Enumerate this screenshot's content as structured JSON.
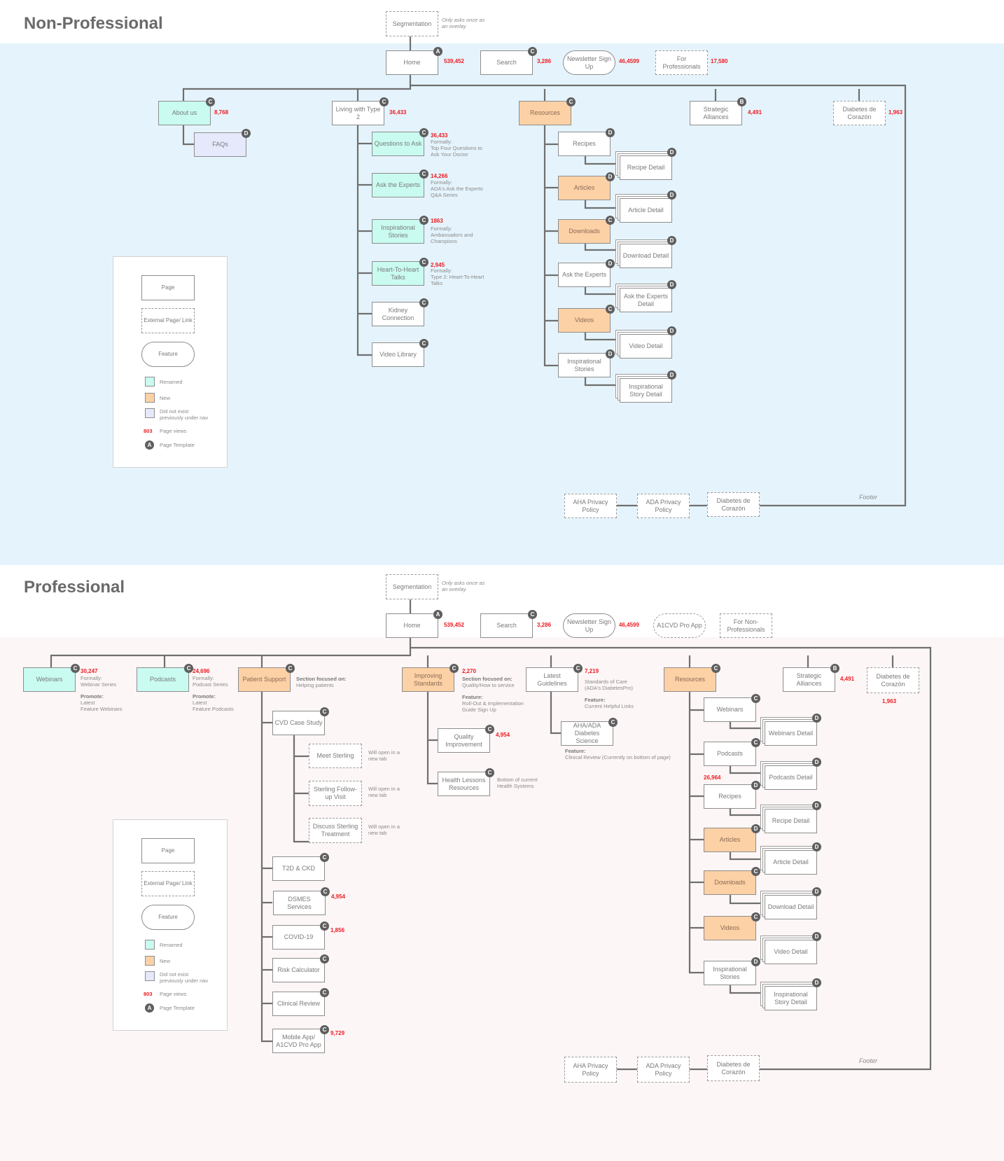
{
  "colors": {
    "renamed": "#c9fbf0",
    "new": "#fdd1a6",
    "not_existing": "#e6e9fc",
    "page_views": "#ee1c24",
    "badge": "#5f5f5f",
    "non_professional_bg": "#e5f4fc",
    "professional_bg": "#fdf6f6"
  },
  "legend": {
    "page": "Page",
    "external": "External Page/ Link",
    "feature": "Feature",
    "renamed": "Renamed",
    "new": "New",
    "not_existing": "Did not exist\npreviously under nav",
    "views_sample": "803",
    "views_label": "Page views",
    "template_sample": "A",
    "template_label": "Page Template"
  },
  "non_professional": {
    "title": "Non-Professional",
    "segmentation": "Segmentation",
    "segmentation_note": "Only asks once as\nan overlay",
    "footer_label": "Footer",
    "nodes": {
      "home": {
        "label": "Home",
        "badge": "A",
        "views": "539,452"
      },
      "search": {
        "label": "Search",
        "badge": "C",
        "views": "3,286"
      },
      "newsletter": {
        "label": "Newsletter Sign Up",
        "views": "46,4599"
      },
      "for_professionals": {
        "label": "For Professionals",
        "views": "17,580"
      },
      "about": {
        "label": "About us",
        "badge": "C",
        "views": "8,768"
      },
      "faqs": {
        "label": "FAQs",
        "badge": "D"
      },
      "living": {
        "label": "Living with Type 2",
        "badge": "C",
        "views": "36,433"
      },
      "questions": {
        "label": "Questions to Ask",
        "badge": "C",
        "views": "36,433",
        "note": "Formally:\nTop Four Questions to\nAsk Your Doctor"
      },
      "ask_experts": {
        "label": "Ask the Experts",
        "badge": "C",
        "views": "14,266",
        "note": "Formally:\nADA's Ask the Experts\nQ&A Series"
      },
      "inspirational": {
        "label": "Inspirational Stories",
        "badge": "C",
        "views": "1863",
        "note": "Formally:\nAmbassadors and\nChampions"
      },
      "heart": {
        "label": "Heart-To-Heart Talks",
        "badge": "C",
        "views": "2,945",
        "note": "Formally:\nType 2: Heart-To-Heart\nTalks"
      },
      "kidney": {
        "label": "Kidney Connection",
        "badge": "C"
      },
      "video_library": {
        "label": "Video Library",
        "badge": "C"
      },
      "resources": {
        "label": "Resources",
        "badge": "C"
      },
      "recipes": {
        "label": "Recipes",
        "badge": "D"
      },
      "recipe_detail": {
        "label": "Recipe Detail",
        "badge": "D"
      },
      "articles": {
        "label": "Articles",
        "badge": "D"
      },
      "article_detail": {
        "label": "Article Detail",
        "badge": "D"
      },
      "downloads": {
        "label": "Downloads",
        "badge": "C"
      },
      "download_detail": {
        "label": "Download Detail",
        "badge": "D"
      },
      "res_ask": {
        "label": "Ask the Experts",
        "badge": "D"
      },
      "res_ask_detail": {
        "label": "Ask the Experts Detail",
        "badge": "D"
      },
      "videos": {
        "label": "Videos",
        "badge": "C"
      },
      "video_detail": {
        "label": "Video Detail",
        "badge": "D"
      },
      "res_insp": {
        "label": "Inspirational Stories",
        "badge": "D"
      },
      "insp_detail": {
        "label": "Inspirational Story Detail",
        "badge": "D"
      },
      "strategic": {
        "label": "Strategic Alliances",
        "badge": "B",
        "views": "4,491"
      },
      "corazon": {
        "label": "Diabetes de Corazón",
        "views": "1,963"
      },
      "aha_privacy": {
        "label": "AHA Privacy Policy"
      },
      "ada_privacy": {
        "label": "ADA Privacy Policy"
      },
      "footer_corazon": {
        "label": "Diabetes de Corazón"
      }
    }
  },
  "professional": {
    "title": "Professional",
    "segmentation": "Segmentation",
    "segmentation_note": "Only asks once as\nan overlay",
    "footer_label": "Footer",
    "nodes": {
      "home": {
        "label": "Home",
        "badge": "A",
        "views": "539,452"
      },
      "search": {
        "label": "Search",
        "badge": "C",
        "views": "3,286"
      },
      "newsletter": {
        "label": "Newsletter Sign Up",
        "views": "46,4599"
      },
      "a1cvd": {
        "label": "A1CVD Pro App"
      },
      "for_nonpro": {
        "label": "For Non-Professionals"
      },
      "webinars": {
        "label": "Webinars",
        "badge": "C",
        "views": "30,247",
        "note": "Formally:\nWebinar Series",
        "note2_hd": "Promote:",
        "note2": "Latest\nFeature Webinars"
      },
      "podcasts": {
        "label": "Podcasts",
        "badge": "C",
        "views": "24,696",
        "note": "Formally:\nPodcast Series",
        "note2_hd": "Promote:",
        "note2": "Latest\nFeature Podcasts"
      },
      "patient_support": {
        "label": "Patient Support",
        "badge": "C",
        "note_hd": "Section focused on:",
        "note": "Helping patients"
      },
      "cvd_case": {
        "label": "CVD Case Study",
        "badge": "C"
      },
      "meet_sterling": {
        "label": "Meet Sterling",
        "note": "Will open in a\nnew tab"
      },
      "sterling_followup": {
        "label": "Sterling Follow-up Visit",
        "note": "Will open in a\nnew tab"
      },
      "discuss_sterling": {
        "label": "Discuss Sterling Treatment",
        "note": "Will open in a\nnew tab"
      },
      "t2d": {
        "label": "T2D & CKD",
        "badge": "C"
      },
      "dsmes": {
        "label": "DSMES Services",
        "badge": "C",
        "views": "4,954"
      },
      "covid": {
        "label": "COVID-19",
        "badge": "C",
        "views": "1,856"
      },
      "risk": {
        "label": "Risk Calculator",
        "badge": "C"
      },
      "clinical": {
        "label": "Clinical Review",
        "badge": "C"
      },
      "mobile_app": {
        "label": "Mobile App/ A1CVD Pro App",
        "badge": "C",
        "views": "9,729"
      },
      "improving": {
        "label": "Improving Standards",
        "badge": "C",
        "views": "2,270",
        "note_hd": "Section focused on:",
        "note": "Quality/How to service",
        "note2_hd": "Feature:",
        "note2": "Roll-Out & Implementation\nGuide Sign Up"
      },
      "quality": {
        "label": "Quality Improvement",
        "badge": "C",
        "views": "4,954"
      },
      "health_lessons": {
        "label": "Health Lessons Resources",
        "badge": "C",
        "note": "Bottom of current\nHealth Systems"
      },
      "guidelines": {
        "label": "Latest Guidelines",
        "badge": "C",
        "views": "7,219",
        "note": "Standards of Care\n(ADA's DiabetesPro)",
        "note2_hd": "Feature:",
        "note2": "Current Helpful Links"
      },
      "aha_ada": {
        "label": "AHA/ADA Diabetes Science",
        "badge": "C",
        "note_hd": "Feature:",
        "note": "Clinical Review (Currently on bottom of page)"
      },
      "resources": {
        "label": "Resources",
        "badge": "C"
      },
      "r_webinars": {
        "label": "Webinars",
        "badge": "C"
      },
      "r_webinars_detail": {
        "label": "Webinars Detail",
        "badge": "D"
      },
      "r_podcasts": {
        "label": "Podcasts",
        "badge": "C"
      },
      "r_podcasts_detail": {
        "label": "Podcasts Detail",
        "badge": "D"
      },
      "r_recipes": {
        "label": "Recipes",
        "badge": "D",
        "views": "26,964"
      },
      "r_recipe_detail": {
        "label": "Recipe Detail",
        "badge": "D"
      },
      "r_articles": {
        "label": "Articles",
        "badge": "D"
      },
      "r_article_detail": {
        "label": "Article Detail",
        "badge": "D"
      },
      "r_downloads": {
        "label": "Downloads",
        "badge": "C"
      },
      "r_download_detail": {
        "label": "Download Detail",
        "badge": "D"
      },
      "r_videos": {
        "label": "Videos",
        "badge": "C"
      },
      "r_video_detail": {
        "label": "Video Detail",
        "badge": "D"
      },
      "r_insp": {
        "label": "Inspirational Stories",
        "badge": "D"
      },
      "r_insp_detail": {
        "label": "Inspirational Story Detail",
        "badge": "D"
      },
      "strategic": {
        "label": "Strategic Alliances",
        "badge": "B",
        "views": "4,491"
      },
      "corazon": {
        "label": "Diabetes de Corazón",
        "views": "1,963"
      },
      "aha_privacy": {
        "label": "AHA Privacy Policy"
      },
      "ada_privacy": {
        "label": "ADA Privacy Policy"
      },
      "footer_corazon": {
        "label": "Diabetes de Corazón"
      }
    }
  }
}
